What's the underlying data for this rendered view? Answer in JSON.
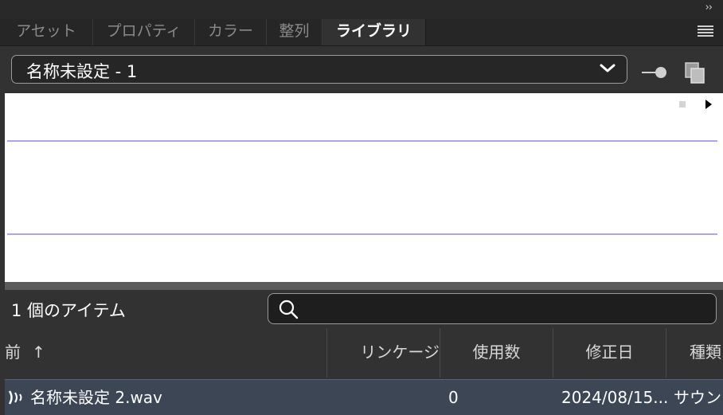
{
  "panel": {
    "collapse_label": "››",
    "tabs": [
      {
        "label": "アセット",
        "active": false
      },
      {
        "label": "プロパティ",
        "active": false
      },
      {
        "label": "カラー",
        "active": false
      },
      {
        "label": "整列",
        "active": false
      },
      {
        "label": "ライブラリ",
        "active": true
      }
    ]
  },
  "library": {
    "selected": "名称未設定 - 1"
  },
  "items": {
    "count_label": "1 個のアイテム",
    "search_placeholder": ""
  },
  "table": {
    "columns": [
      {
        "label": "前",
        "sorted": "ascending",
        "sort_glyph": "↑"
      },
      {
        "label": "リンケージ"
      },
      {
        "label": "使用数"
      },
      {
        "label": "修正日"
      },
      {
        "label": "種類"
      }
    ],
    "rows": [
      {
        "name": "名称未設定 2.wav",
        "linkage": "",
        "uses": "0",
        "modified": "2024/08/15...",
        "type": "サウン"
      }
    ]
  },
  "colors": {
    "panel_bg": "#323232",
    "tab_bg": "#262626",
    "waveform": "#a9a7ea",
    "selected_row": "#3d4655"
  }
}
